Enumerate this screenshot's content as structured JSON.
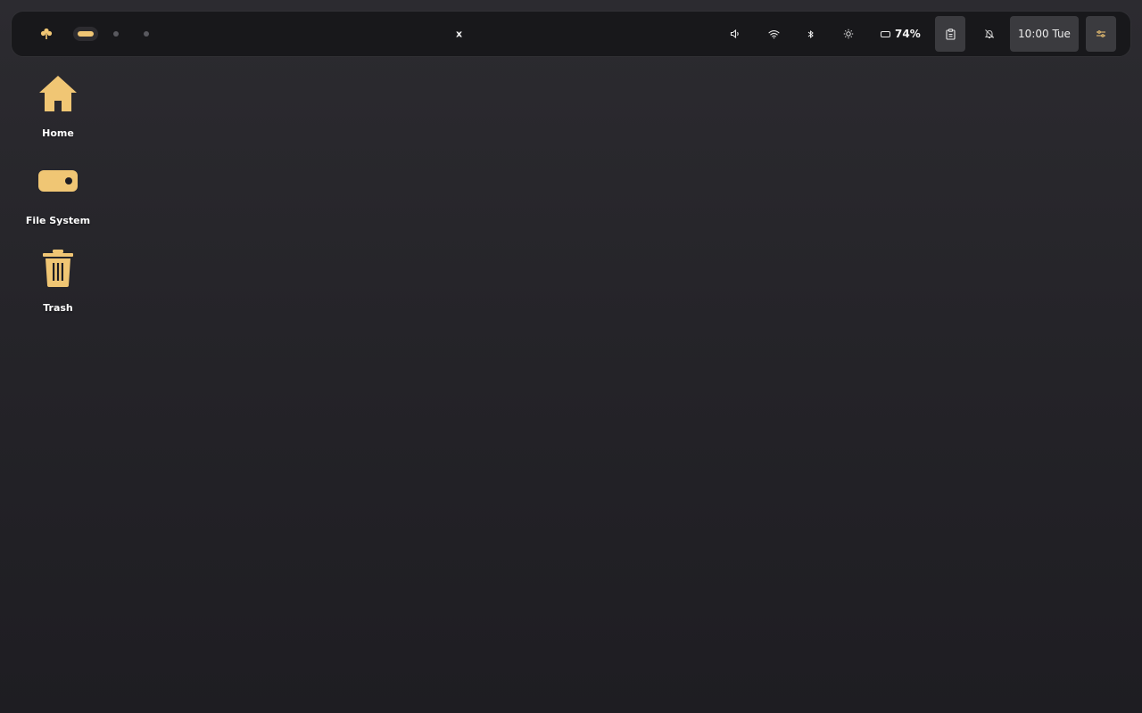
{
  "colors": {
    "accent": "#f0c674",
    "bar_background": "#18181b",
    "button_background": "#3b3b3f"
  },
  "topbar": {
    "launcher_icon": "flower-icon",
    "workspaces": [
      {
        "id": 1,
        "active": true
      },
      {
        "id": 2,
        "active": false
      },
      {
        "id": 3,
        "active": false
      }
    ],
    "window_title": "x",
    "tray": {
      "volume_icon": "volume-icon",
      "wifi_icon": "wifi-icon",
      "bluetooth_icon": "bluetooth-icon",
      "brightness_icon": "brightness-icon",
      "battery_text": "74%",
      "clipboard_icon": "clipboard-icon",
      "notifications_icon": "bell-off-icon",
      "clock": "10:00 Tue",
      "settings_icon": "sliders-icon"
    }
  },
  "desktop": {
    "icons": [
      {
        "label": "Home",
        "icon": "home-icon"
      },
      {
        "label": "File System",
        "icon": "drive-icon"
      },
      {
        "label": "Trash",
        "icon": "trash-icon"
      }
    ]
  }
}
